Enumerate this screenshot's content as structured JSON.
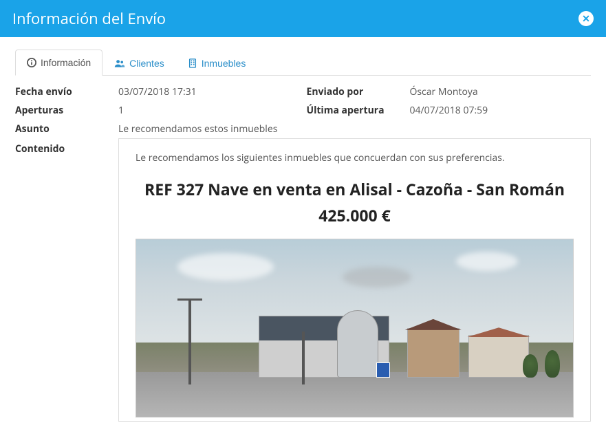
{
  "modal": {
    "title": "Información del Envío"
  },
  "tabs": {
    "info": "Información",
    "clientes": "Clientes",
    "inmuebles": "Inmuebles"
  },
  "fields": {
    "fecha_envio_label": "Fecha envío",
    "fecha_envio_value": "03/07/2018 17:31",
    "enviado_por_label": "Enviado por",
    "enviado_por_value": "Óscar Montoya",
    "aperturas_label": "Aperturas",
    "aperturas_value": "1",
    "ultima_apertura_label": "Última apertura",
    "ultima_apertura_value": "04/07/2018 07:59",
    "asunto_label": "Asunto",
    "asunto_value": "Le recomendamos estos inmuebles",
    "contenido_label": "Contenido"
  },
  "content": {
    "intro": "Le recomendamos los siguientes inmuebles que concuerdan con sus preferencias.",
    "title": "REF 327 Nave en venta en Alisal - Cazoña - San Román",
    "price": "425.000 €"
  }
}
